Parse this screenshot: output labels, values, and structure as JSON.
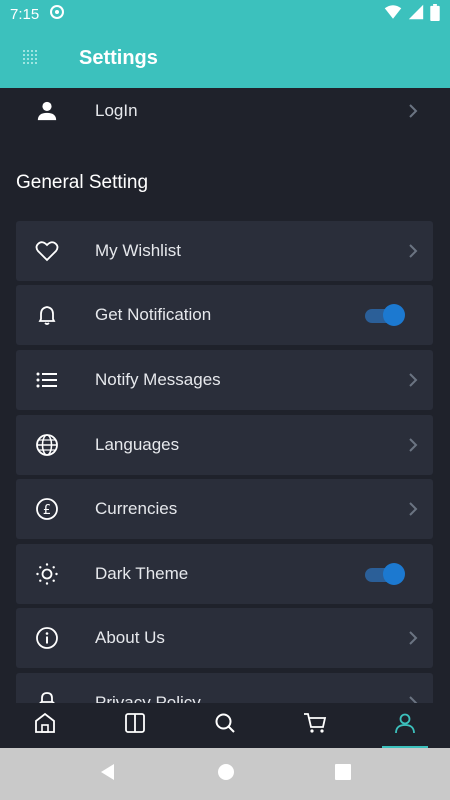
{
  "status": {
    "time": "7:15"
  },
  "appbar": {
    "title": "Settings"
  },
  "login": {
    "label": "LogIn"
  },
  "section": {
    "title": "General Setting"
  },
  "settings": {
    "items": [
      {
        "label": "My Wishlist",
        "icon": "heart-icon",
        "control": "chevron"
      },
      {
        "label": "Get Notification",
        "icon": "bell-icon",
        "control": "toggle",
        "enabled": true
      },
      {
        "label": "Notify Messages",
        "icon": "list-icon",
        "control": "chevron"
      },
      {
        "label": "Languages",
        "icon": "globe-icon",
        "control": "chevron"
      },
      {
        "label": "Currencies",
        "icon": "pound-icon",
        "control": "chevron"
      },
      {
        "label": "Dark Theme",
        "icon": "sun-icon",
        "control": "toggle",
        "enabled": true
      },
      {
        "label": "About Us",
        "icon": "info-icon",
        "control": "chevron"
      },
      {
        "label": "Privacy Policy",
        "icon": "lock-icon",
        "control": "chevron"
      }
    ]
  },
  "bottom_nav": {
    "items": [
      {
        "icon": "home-icon",
        "active": false
      },
      {
        "icon": "categories-icon",
        "active": false
      },
      {
        "icon": "search-icon",
        "active": false
      },
      {
        "icon": "cart-icon",
        "active": false
      },
      {
        "icon": "profile-icon",
        "active": true
      }
    ]
  },
  "colors": {
    "accent": "#3cc1bd",
    "background": "#1f222b",
    "card": "#2a2e3a",
    "toggle_on": "#1c79d0"
  }
}
